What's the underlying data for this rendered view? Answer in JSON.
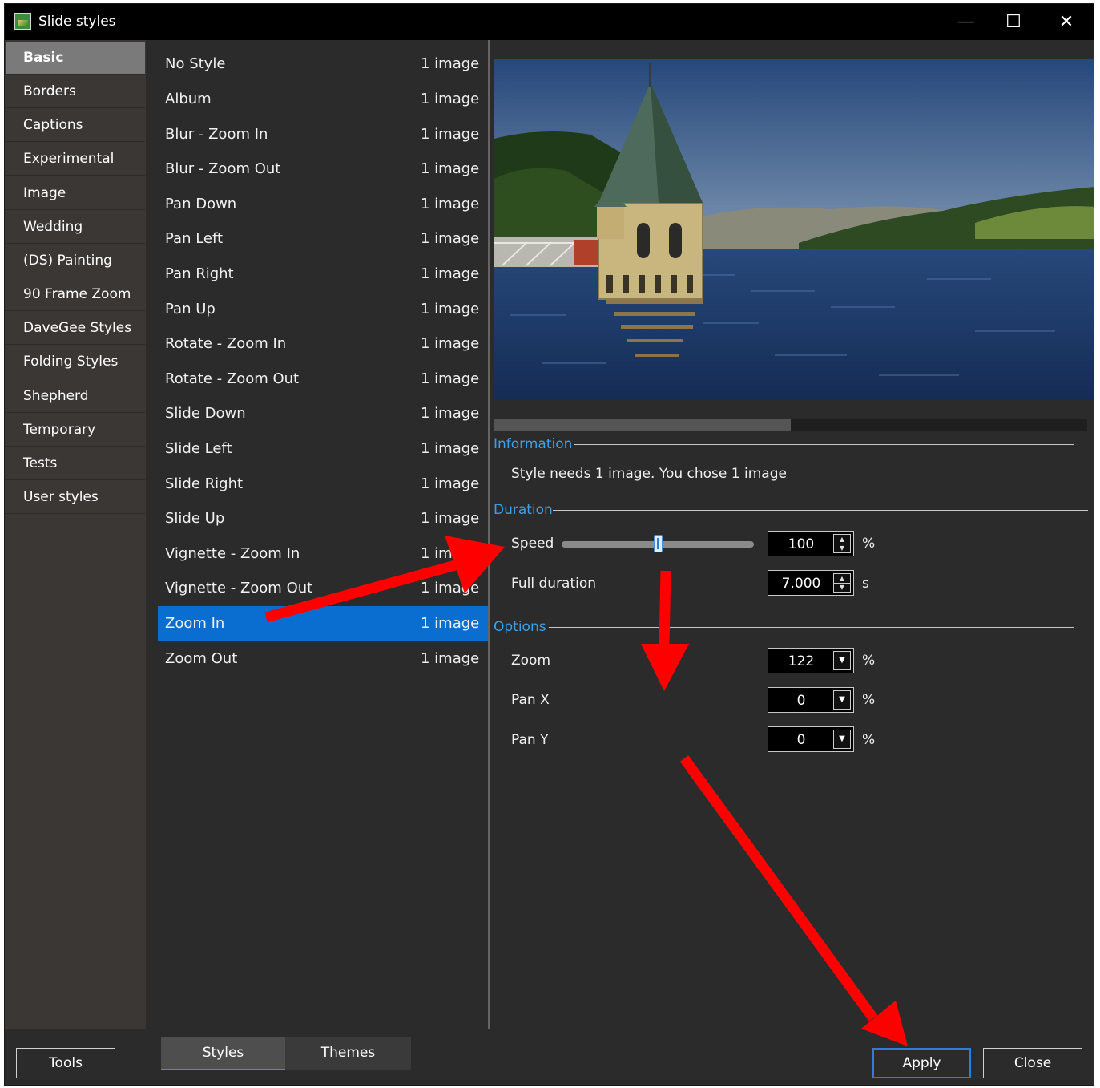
{
  "window": {
    "title": "Slide styles",
    "controls": {
      "minimize": "—",
      "maximize": "☐",
      "close": "✕"
    }
  },
  "categories": [
    {
      "label": "Basic",
      "active": true
    },
    {
      "label": "Borders"
    },
    {
      "label": "Captions"
    },
    {
      "label": "Experimental"
    },
    {
      "label": "Image"
    },
    {
      "label": "Wedding"
    },
    {
      "label": "(DS) Painting"
    },
    {
      "label": "90 Frame Zoom"
    },
    {
      "label": "DaveGee Styles"
    },
    {
      "label": "Folding Styles"
    },
    {
      "label": "Shepherd"
    },
    {
      "label": "Temporary"
    },
    {
      "label": "Tests"
    },
    {
      "label": "User styles"
    }
  ],
  "styles": [
    {
      "name": "No Style",
      "count": "1 image"
    },
    {
      "name": "Album",
      "count": "1 image"
    },
    {
      "name": "Blur - Zoom In",
      "count": "1 image"
    },
    {
      "name": "Blur - Zoom Out",
      "count": "1 image"
    },
    {
      "name": "Pan Down",
      "count": "1 image"
    },
    {
      "name": "Pan Left",
      "count": "1 image"
    },
    {
      "name": "Pan Right",
      "count": "1 image"
    },
    {
      "name": "Pan Up",
      "count": "1 image"
    },
    {
      "name": "Rotate - Zoom In",
      "count": "1 image"
    },
    {
      "name": "Rotate - Zoom Out",
      "count": "1 image"
    },
    {
      "name": "Slide Down",
      "count": "1 image"
    },
    {
      "name": "Slide Left",
      "count": "1 image"
    },
    {
      "name": "Slide Right",
      "count": "1 image"
    },
    {
      "name": "Slide Up",
      "count": "1 image"
    },
    {
      "name": "Vignette - Zoom In",
      "count": "1 image"
    },
    {
      "name": "Vignette - Zoom Out",
      "count": "1 image"
    },
    {
      "name": "Zoom In",
      "count": "1 image",
      "selected": true
    },
    {
      "name": "Zoom Out",
      "count": "1 image"
    }
  ],
  "information": {
    "heading": "Information",
    "text": "Style needs 1 image. You chose 1 image"
  },
  "duration": {
    "heading": "Duration",
    "speed_label": "Speed",
    "speed_value": "100",
    "speed_unit": "%",
    "speed_slider_fraction": 0.5,
    "full_duration_label": "Full duration",
    "full_duration_value": "7.000",
    "full_duration_unit": "s"
  },
  "options": {
    "heading": "Options",
    "zoom_label": "Zoom",
    "zoom_value": "122",
    "zoom_unit": "%",
    "panx_label": "Pan X",
    "panx_value": "0",
    "panx_unit": "%",
    "pany_label": "Pan Y",
    "pany_value": "0",
    "pany_unit": "%"
  },
  "bottom": {
    "tools": "Tools",
    "tab_styles": "Styles",
    "tab_themes": "Themes",
    "apply": "Apply",
    "close": "Close"
  },
  "colors": {
    "accent": "#0a6ed1",
    "section_heading": "#3aa0e8",
    "annotation_arrow": "#ff0000"
  }
}
